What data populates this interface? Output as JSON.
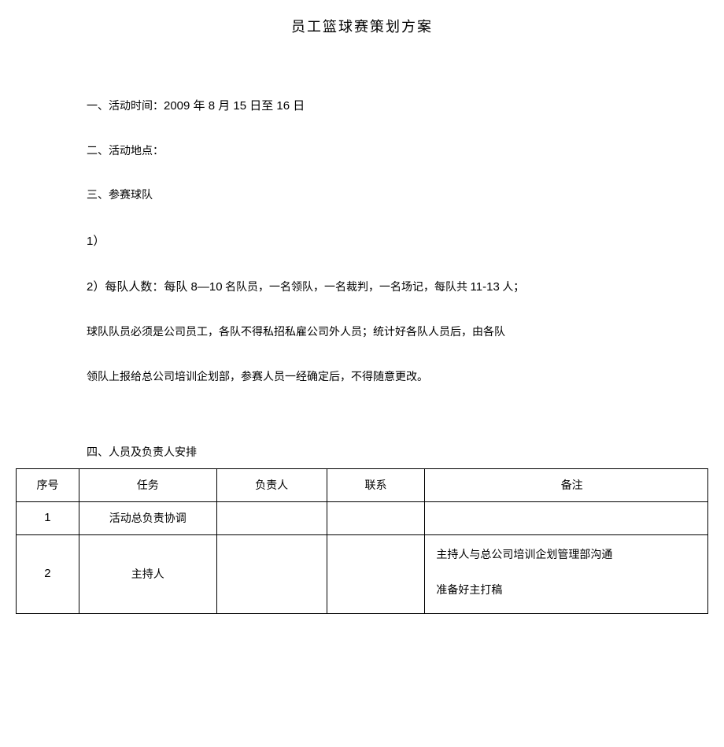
{
  "title": "员工篮球赛策划方案",
  "sections": {
    "s1": "一、活动时间：",
    "s1_date": "2009 年 8 月 15 日至 16 日",
    "s2": "二、活动地点：",
    "s3": "三、参赛球队",
    "s3_1": "1）",
    "s3_2_pre": "2）每队人数：每队 ",
    "s3_2_num1": "8—10",
    "s3_2_mid": " 名队员，一名领队，一名裁判，一名场记，每队共 ",
    "s3_2_num2": "11-13",
    "s3_2_post": " 人；",
    "s3_p1": "球队队员必须是公司员工，各队不得私招私雇公司外人员；统计好各队人员后，由各队",
    "s3_p2": "领队上报给总公司培训企划部，参赛人员一经确定后，不得随意更改。",
    "s4": "四、人员及负责人安排"
  },
  "table": {
    "headers": {
      "seq": "序号",
      "task": "任务",
      "person": "负责人",
      "contact": "联系",
      "remark": "备注"
    },
    "rows": [
      {
        "seq": "1",
        "task": "活动总负责协调",
        "person": "",
        "contact": "",
        "remark": ""
      },
      {
        "seq": "2",
        "task": "主持人",
        "person": "",
        "contact": "",
        "remark_line1": "主持人与总公司培训企划管理部沟通",
        "remark_line2": "准备好主打稿"
      }
    ]
  }
}
